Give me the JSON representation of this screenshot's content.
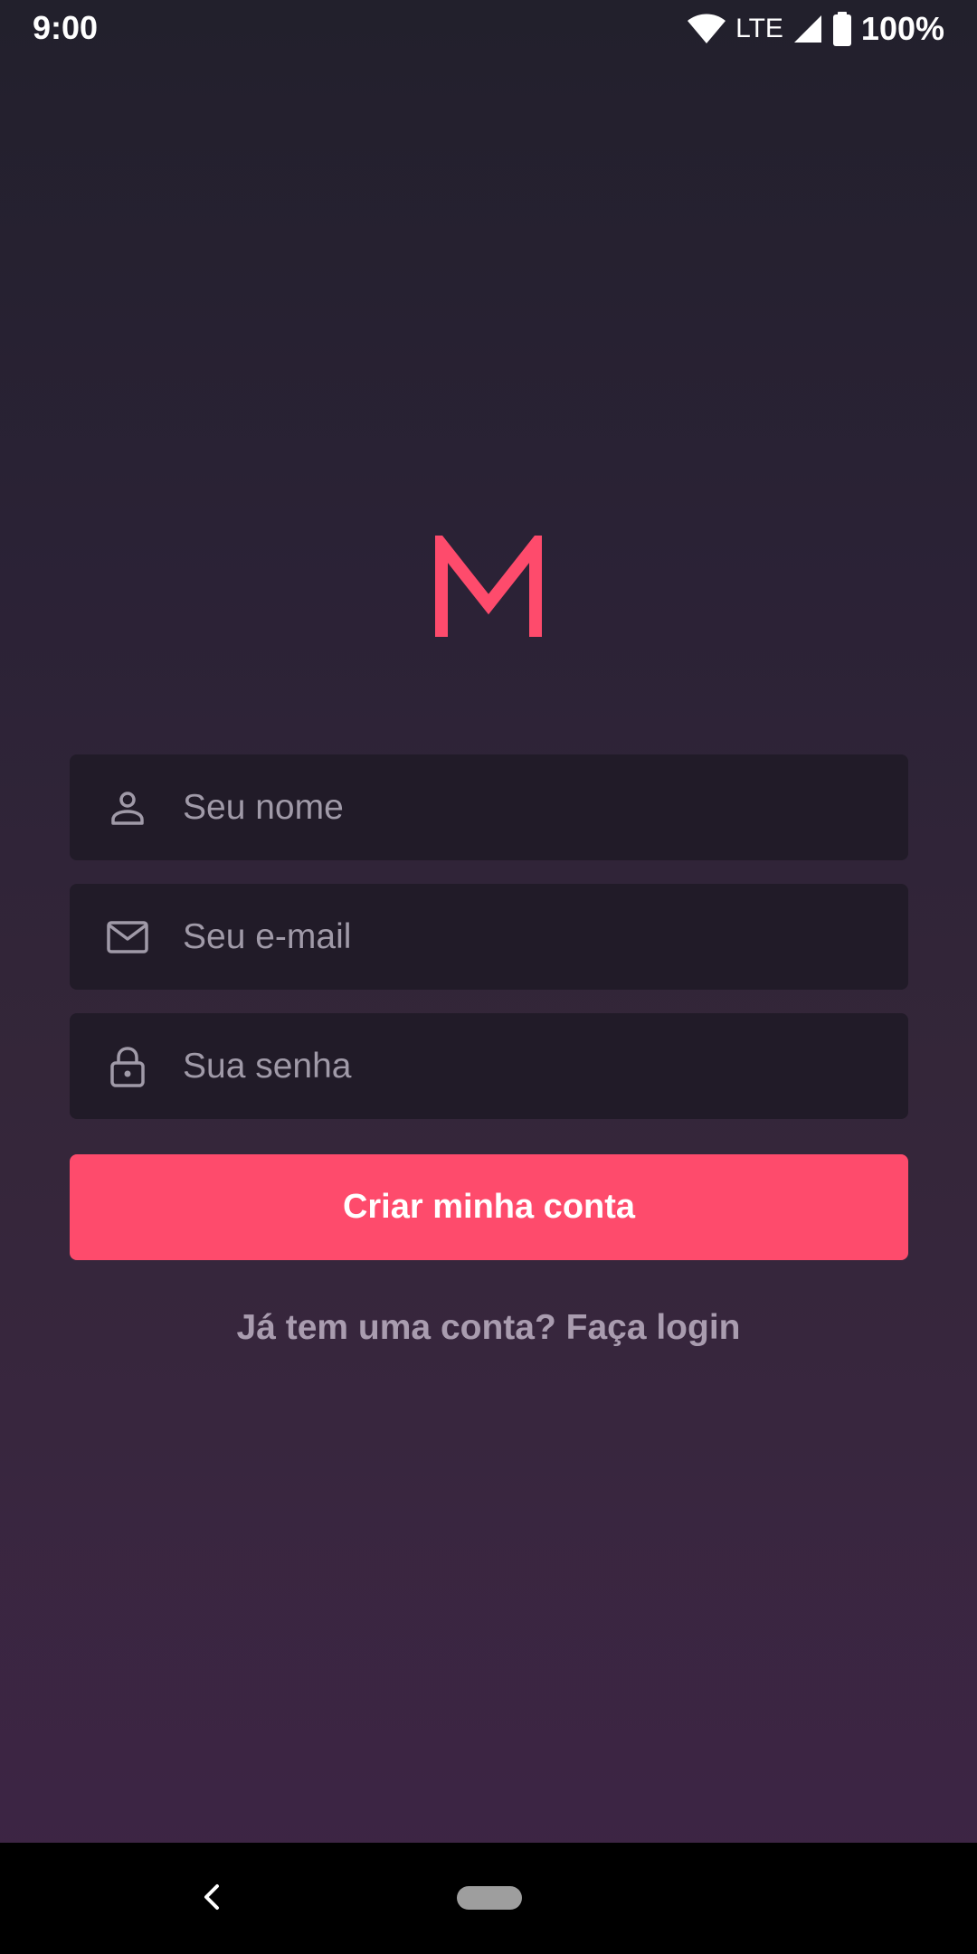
{
  "status_bar": {
    "time": "9:00",
    "network": "LTE",
    "battery": "100%",
    "icons": [
      "wifi-icon",
      "signal-icon",
      "battery-icon"
    ]
  },
  "logo": {
    "text": "M",
    "color": "#fe4b6c"
  },
  "form": {
    "name_field": {
      "icon": "person-icon",
      "placeholder": "Seu nome",
      "value": ""
    },
    "email_field": {
      "icon": "mail-icon",
      "placeholder": "Seu e-mail",
      "value": ""
    },
    "password_field": {
      "icon": "lock-icon",
      "placeholder": "Sua senha",
      "value": ""
    },
    "submit_label": "Criar minha conta"
  },
  "login_link": "Já tem uma conta? Faça login",
  "nav_bar": {
    "icons": [
      "back-icon",
      "home-pill"
    ]
  },
  "colors": {
    "accent": "#fe4b6c",
    "field_background": "#211b28",
    "placeholder": "#a09aa8",
    "link": "#a99caf",
    "background_top": "#22202c",
    "background_bottom": "#3e2546"
  }
}
